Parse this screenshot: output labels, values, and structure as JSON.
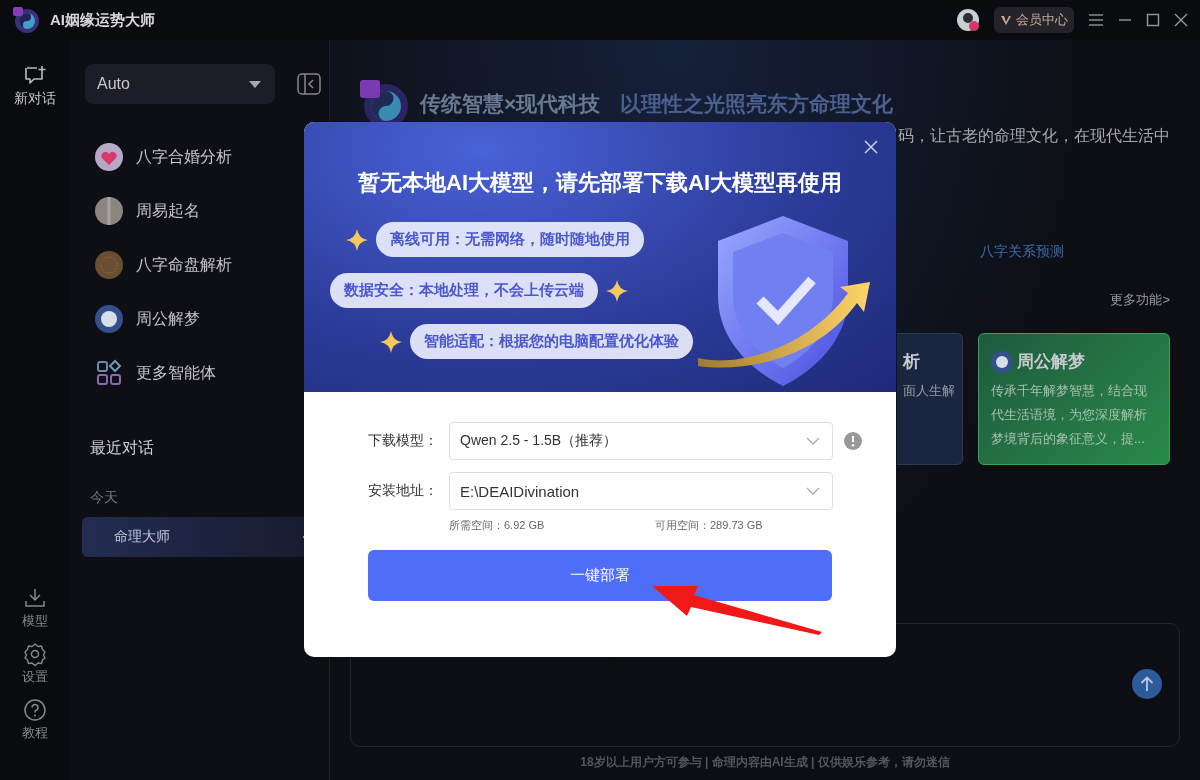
{
  "app": {
    "title": "AI姻缘运势大师"
  },
  "title_bar": {
    "vip_label": "会员中心"
  },
  "rail": {
    "top_items": [
      {
        "label": "新对话",
        "kind": "new-chat"
      }
    ],
    "bottom_items": [
      {
        "label": "模型",
        "kind": "download"
      },
      {
        "label": "设置",
        "kind": "settings"
      },
      {
        "label": "教程",
        "kind": "help"
      }
    ]
  },
  "sidebar": {
    "model_select": {
      "value": "Auto"
    },
    "agents": [
      {
        "label": "八字合婚分析",
        "kind": "heart"
      },
      {
        "label": "周易起名",
        "kind": "stone"
      },
      {
        "label": "八字命盘解析",
        "kind": "disc"
      },
      {
        "label": "周公解梦",
        "kind": "moon"
      },
      {
        "label": "更多智能体",
        "kind": "grid"
      }
    ],
    "recent_title": "最近对话",
    "groups": [
      {
        "label": "今天",
        "chats": [
          {
            "title": "命理大师",
            "selected": true
          }
        ]
      }
    ]
  },
  "main": {
    "headline_accent": "传统智慧×现代科技",
    "headline": "以理性之光照亮东方命理文化",
    "intro_fragment": "码，让古老的命理文化，在现代生活中",
    "tab": "八字关系预测",
    "more_link": "更多功能>",
    "cards": [
      {
        "kind": "plain",
        "title": "析",
        "desc": "面人生解"
      },
      {
        "kind": "highlight",
        "title": "周公解梦",
        "desc": "传承千年解梦智慧，结合现代生活语境，为您深度解析梦境背后的象征意义，提..."
      }
    ],
    "disclaimer": "18岁以上用户方可参与 | 命理内容由AI生成 | 仅供娱乐参考，请勿迷信"
  },
  "dialog": {
    "title": "暂无本地AI大模型，请先部署下载AI大模型再使用",
    "features": [
      "离线可用：无需网络，随时随地使用",
      "数据安全：本地处理，不会上传云端",
      "智能适配：根据您的电脑配置优化体验"
    ],
    "fields": [
      {
        "label": "下载模型：",
        "value": "Qwen 2.5 - 1.5B（推荐）",
        "info": true
      },
      {
        "label": "安装地址：",
        "value": "E:\\DEAIDivination",
        "info": false
      }
    ],
    "required_space": "所需空间：6.92 GB",
    "free_space": "可用空间：289.73 GB",
    "deploy_button": "一键部署"
  }
}
